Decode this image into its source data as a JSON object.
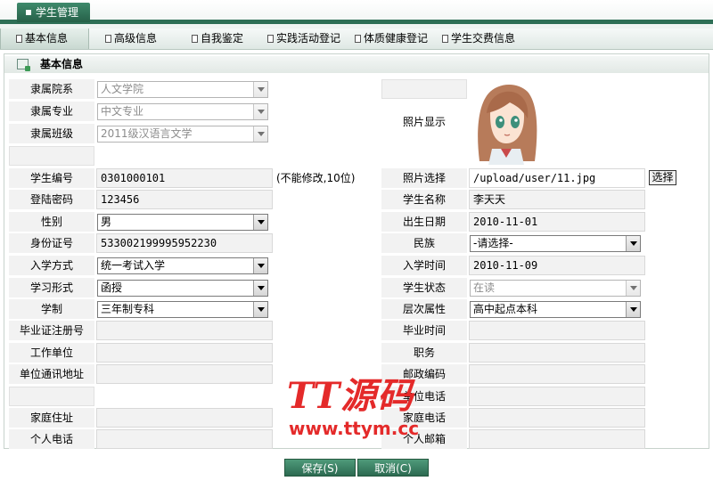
{
  "app": {
    "tab_label": "学生管理"
  },
  "nav": {
    "items": [
      "基本信息",
      "高级信息",
      "自我鉴定",
      "实践活动登记",
      "体质健康登记",
      "学生交费信息"
    ]
  },
  "panel": {
    "title": "基本信息"
  },
  "left": {
    "college": {
      "label": "隶属院系",
      "value": "人文学院"
    },
    "major": {
      "label": "隶属专业",
      "value": "中文专业"
    },
    "class": {
      "label": "隶属班级",
      "value": "2011级汉语言文学"
    },
    "student_no": {
      "label": "学生编号",
      "value": "0301000101",
      "note": "(不能修改,10位)"
    },
    "password": {
      "label": "登陆密码",
      "value": "123456"
    },
    "gender": {
      "label": "性别",
      "value": "男"
    },
    "id_card": {
      "label": "身份证号",
      "value": "533002199995952230"
    },
    "admission_method": {
      "label": "入学方式",
      "value": "统一考试入学"
    },
    "study_form": {
      "label": "学习形式",
      "value": "函授"
    },
    "duration": {
      "label": "学制",
      "value": "三年制专科"
    },
    "grad_cert": {
      "label": "毕业证注册号",
      "value": ""
    },
    "work_unit": {
      "label": "工作单位",
      "value": ""
    },
    "unit_address": {
      "label": "单位通讯地址",
      "value": ""
    },
    "home_address": {
      "label": "家庭住址",
      "value": ""
    },
    "personal_phone": {
      "label": "个人电话",
      "value": ""
    }
  },
  "right": {
    "photo_display": {
      "label": "照片显示"
    },
    "photo_select": {
      "label": "照片选择",
      "value": "/upload/user/11.jpg",
      "button": "选择"
    },
    "student_name": {
      "label": "学生名称",
      "value": "李天天"
    },
    "birth_date": {
      "label": "出生日期",
      "value": "2010-11-01"
    },
    "ethnicity": {
      "label": "民族",
      "value": "-请选择-"
    },
    "enroll_time": {
      "label": "入学时间",
      "value": "2010-11-09"
    },
    "status": {
      "label": "学生状态",
      "value": "在读"
    },
    "level": {
      "label": "层次属性",
      "value": "高中起点本科"
    },
    "grad_time": {
      "label": "毕业时间",
      "value": ""
    },
    "position": {
      "label": "职务",
      "value": ""
    },
    "postcode": {
      "label": "邮政编码",
      "value": ""
    },
    "unit_phone": {
      "label": "单位电话",
      "value": ""
    },
    "home_phone": {
      "label": "家庭电话",
      "value": ""
    },
    "email": {
      "label": "个人邮箱",
      "value": ""
    }
  },
  "actions": {
    "save": "保存(S)",
    "cancel": "取消(C)"
  },
  "watermark": {
    "line1": "TT源码",
    "line2": "www.ttym.cc"
  }
}
